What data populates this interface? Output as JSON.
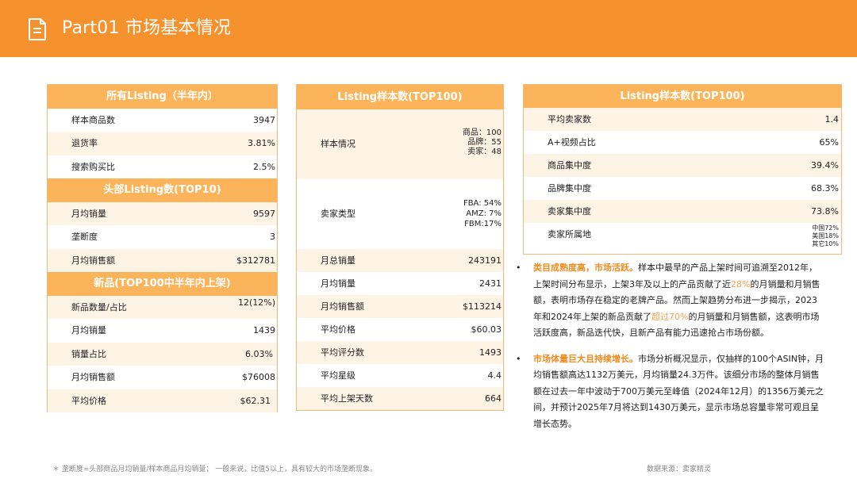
{
  "header": {
    "title": "Part01 市场基本情况",
    "icon": "document-icon",
    "color": "#f6922d"
  },
  "card1": {
    "sections": [
      {
        "heading": "所有Listing（半年内）",
        "rows": [
          {
            "label": "样本商品数",
            "value": "3947"
          },
          {
            "label": "退货率",
            "value": "3.81%"
          },
          {
            "label": "搜索购买比",
            "value": "2.5%"
          }
        ]
      },
      {
        "heading": "头部Listing数(TOP10)",
        "rows": [
          {
            "label": "月均销量",
            "value": "9597"
          },
          {
            "label": "垄断度",
            "value": "3"
          },
          {
            "label": "月均销售额",
            "value": "$312781"
          }
        ]
      },
      {
        "heading": "新品(TOP100中半年内上架)",
        "rows": [
          {
            "label": "新品数量/占比",
            "value": "12(12%)"
          },
          {
            "label": "月均销量",
            "value": "1439"
          },
          {
            "label": "销量占比",
            "value": "6.03%"
          },
          {
            "label": "月均销售额",
            "value": "$76008"
          },
          {
            "label": "平均价格",
            "value": "$62.31"
          }
        ]
      }
    ]
  },
  "card2": {
    "heading": "Listing样本数(TOP100)",
    "sample": {
      "label": "样本情况",
      "lines": [
        "商品：100",
        "品牌：55",
        "卖家：48"
      ]
    },
    "seller_type": {
      "label": "卖家类型",
      "lines": [
        "FBA: 54%",
        "AMZ: 7%",
        "FBM:17%"
      ]
    },
    "rows": [
      {
        "label": "月总销量",
        "value": "243191"
      },
      {
        "label": "月均销量",
        "value": "2431"
      },
      {
        "label": "月均销售额",
        "value": "$113214"
      },
      {
        "label": "平均价格",
        "value": "$60.03"
      },
      {
        "label": "平均评分数",
        "value": "1493"
      },
      {
        "label": "平均星级",
        "value": "4.4"
      },
      {
        "label": "平均上架天数",
        "value": "664"
      }
    ]
  },
  "card3": {
    "heading": "Listing样本数(TOP100)",
    "rows": [
      {
        "label": "平均卖家数",
        "value": "1.4"
      },
      {
        "label": "A+视频占比",
        "value": "65%"
      },
      {
        "label": "商品集中度",
        "value": "39.4%"
      },
      {
        "label": "品牌集中度",
        "value": "68.3%"
      },
      {
        "label": "卖家集中度",
        "value": "73.8%"
      }
    ],
    "origin": {
      "label": "卖家所属地",
      "lines": [
        "中国72%",
        "美国18%",
        "其它10%"
      ]
    }
  },
  "bullets": {
    "b1": {
      "dot": "•",
      "highlight": "类目成熟度高，市场活跃。",
      "t1": "样本中最早的产品上架时间可追溯至2012年，上架时间分布显示，上架3年及以上的产品贡献了近",
      "n1": "28%",
      "t2": "的月销量和月销售额，表明市场存在稳定的老牌产品。然而上架趋势分布进一步揭示，2023年和2024年上架的新品贡献了",
      "n2": "超过70%",
      "t3": "的月销量和月销售额，这表明市场活跃度高，新品迭代快，且新产品有能力迅速抢占市场份额。"
    },
    "b2": {
      "dot": "•",
      "highlight": "市场体量巨大且持续增长。",
      "t1": "市场分析概况显示，仅抽样的100个ASIN钟，月均销售额高达1132万美元，月均销量24.3万件。该细分市场的整体月销售额在过去一年中波动于700万美元至峰值（2024年12月）的1356万美元之间，并预计2025年7月将达到1430万美元，显示市场总容量非常可观且呈增长态势。"
    }
  },
  "footer": {
    "note": "＊ 垄断度=头部商品月均销量/样本商品月均销量；  一般来说，比值5以上，具有较大的市场垄断现象。",
    "source": "数据来源：卖家精灵"
  }
}
